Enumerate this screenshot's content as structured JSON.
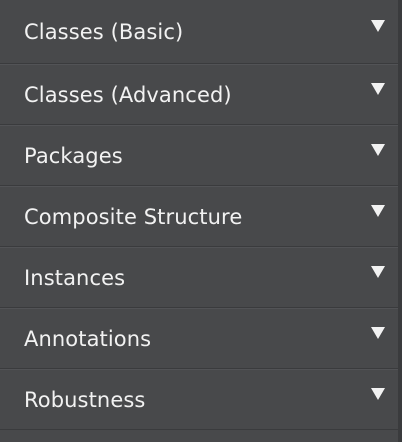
{
  "sections": [
    {
      "label": "Classes (Basic)",
      "icon": "triangle-down-icon"
    },
    {
      "label": "Classes (Advanced)",
      "icon": "triangle-down-icon"
    },
    {
      "label": "Packages",
      "icon": "triangle-down-icon"
    },
    {
      "label": "Composite Structure",
      "icon": "triangle-down-icon"
    },
    {
      "label": "Instances",
      "icon": "triangle-down-icon"
    },
    {
      "label": "Annotations",
      "icon": "triangle-down-icon"
    },
    {
      "label": "Robustness",
      "icon": "triangle-down-icon"
    }
  ],
  "colors": {
    "panel_bg": "#48494b",
    "divider": "#3a3b3d",
    "text": "#f2f2f2"
  }
}
